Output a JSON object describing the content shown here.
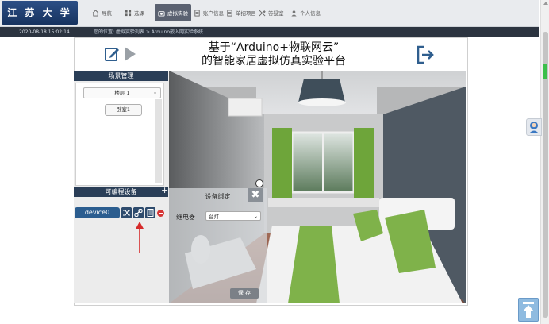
{
  "logo": {
    "text": "江 苏 大 学"
  },
  "nav": [
    {
      "label": "导航",
      "icon": "home-icon"
    },
    {
      "label": "选课",
      "icon": "grid-icon"
    },
    {
      "label": "虚拟实验",
      "icon": "camera-icon",
      "active": true
    },
    {
      "label": "账户信息",
      "icon": "document-icon"
    },
    {
      "label": "单招项目",
      "icon": "document-icon"
    },
    {
      "label": "答疑室",
      "icon": "tools-icon"
    },
    {
      "label": "个人信息",
      "icon": "user-icon"
    }
  ],
  "subbar": {
    "datetime": "2020-08-18  15:02:14",
    "breadcrumb": "您的位置: 虚拟实验列表 > Arduino嵌入网实验系统"
  },
  "title": {
    "line1": "基于“Arduino+物联网云”",
    "line2": "的智能家居虚拟仿真实验平台"
  },
  "scene_panel": {
    "header": "场景管理",
    "floor_value": "楼层 1",
    "room_button": "卧室1"
  },
  "device_panel": {
    "header": "可编程设备",
    "device_label": "device0"
  },
  "binding": {
    "title": "设备绑定",
    "relay_label": "继电器",
    "relay_value": "台灯",
    "save_label": "保 存",
    "close_symbol": "✖"
  },
  "colors": {
    "panel_header": "#2a3e57",
    "device_button": "#2b5d8f",
    "accent_blue": "#2f5e8e",
    "arrow_red": "#d62b2b"
  }
}
